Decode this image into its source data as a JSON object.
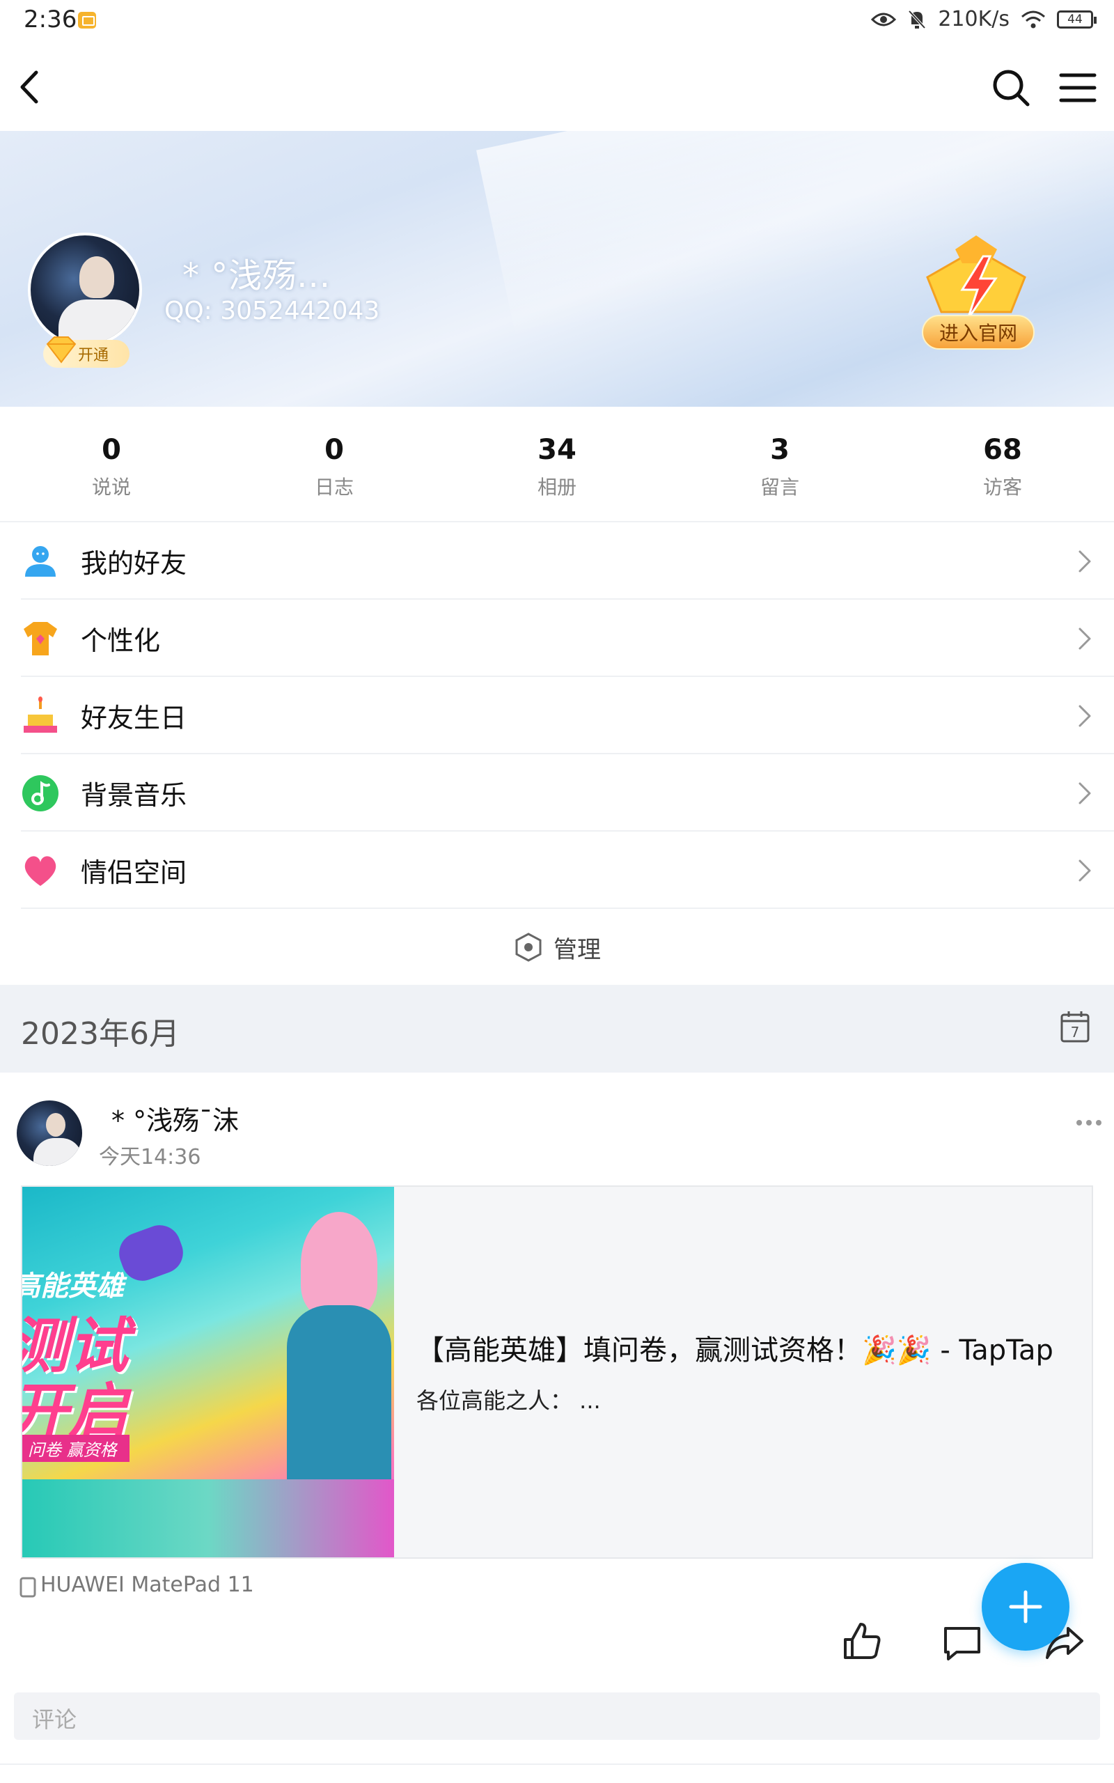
{
  "status_bar": {
    "time": "2:36",
    "net_speed": "210K/s",
    "battery": "44"
  },
  "profile": {
    "nickname": "* °浅殇...",
    "qq": "QQ: 3052442043",
    "vip_label": "开通",
    "official_label": "进入官网"
  },
  "stats": [
    {
      "num": "0",
      "label": "说说"
    },
    {
      "num": "0",
      "label": "日志"
    },
    {
      "num": "34",
      "label": "相册"
    },
    {
      "num": "3",
      "label": "留言"
    },
    {
      "num": "68",
      "label": "访客"
    }
  ],
  "menu": [
    {
      "label": "我的好友",
      "icon": "friends-icon",
      "color": "#35a6f0"
    },
    {
      "label": "个性化",
      "icon": "tshirt-icon",
      "color": "#f7a51c"
    },
    {
      "label": "好友生日",
      "icon": "cake-icon",
      "color": "#f39c1f"
    },
    {
      "label": "背景音乐",
      "icon": "music-icon",
      "color": "#2ec75d"
    },
    {
      "label": "情侣空间",
      "icon": "heart-icon",
      "color": "#f4508a"
    }
  ],
  "manage_label": "管理",
  "month_label": "2023年6月",
  "calendar_day": "7",
  "post": {
    "author": "* °浅殇¯沫",
    "time": "今天14:36",
    "link_title": "【高能英雄】填问卷，赢测试资格！🎉🎉 - TapTap",
    "link_desc": "各位高能之人：   ...",
    "thumb_text1": "高能英雄",
    "thumb_text2a": "测试",
    "thumb_text2b": "开启",
    "thumb_text3": "问卷 赢资格",
    "device": "HUAWEI MatePad 11"
  },
  "comment_placeholder": "评论",
  "colors": {
    "accent": "#1aa6f4",
    "month_band": "#eff2f6"
  }
}
